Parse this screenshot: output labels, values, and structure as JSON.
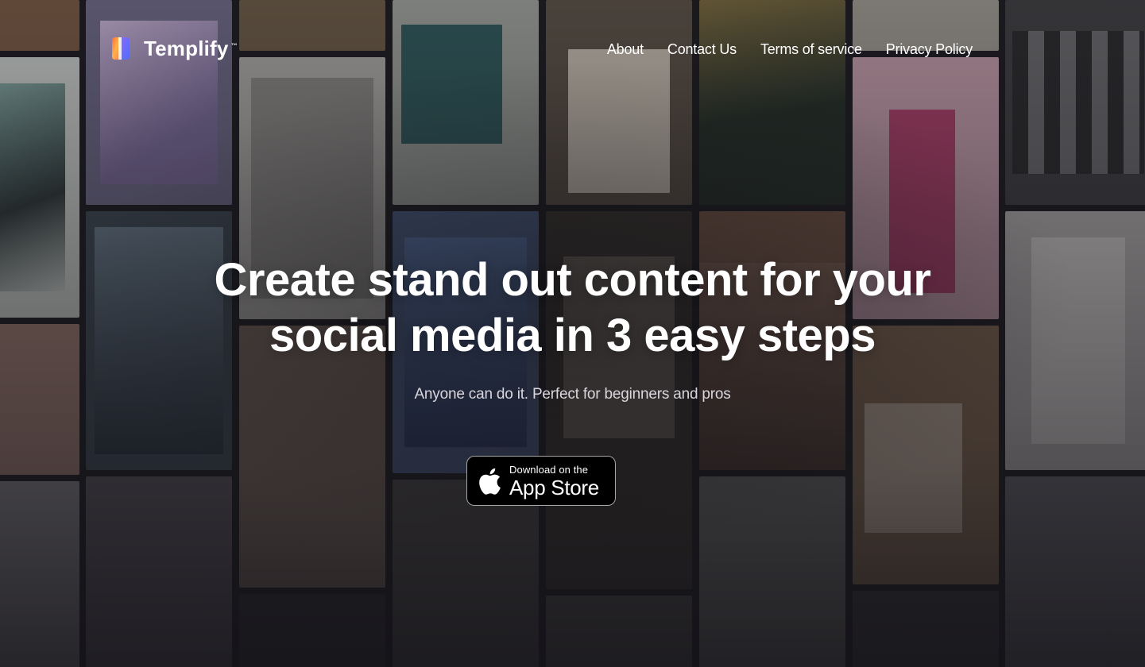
{
  "brand": {
    "name": "Templify",
    "trademark": "™"
  },
  "nav": {
    "items": [
      {
        "label": "About"
      },
      {
        "label": "Contact Us"
      },
      {
        "label": "Terms of service"
      },
      {
        "label": "Privacy Policy"
      }
    ]
  },
  "hero": {
    "headline_line1": "Create stand out content for your",
    "headline_line2": "social media in 3 easy steps",
    "subtitle": "Anyone can do it. Perfect for beginners and pros"
  },
  "cta": {
    "small_label": "Download on the",
    "big_label": "App Store"
  },
  "colors": {
    "background": "#1c1b20",
    "text": "#ffffff",
    "subtitle": "#d9d6dd",
    "button_bg": "#000000",
    "button_border": "#a6a6a6"
  }
}
